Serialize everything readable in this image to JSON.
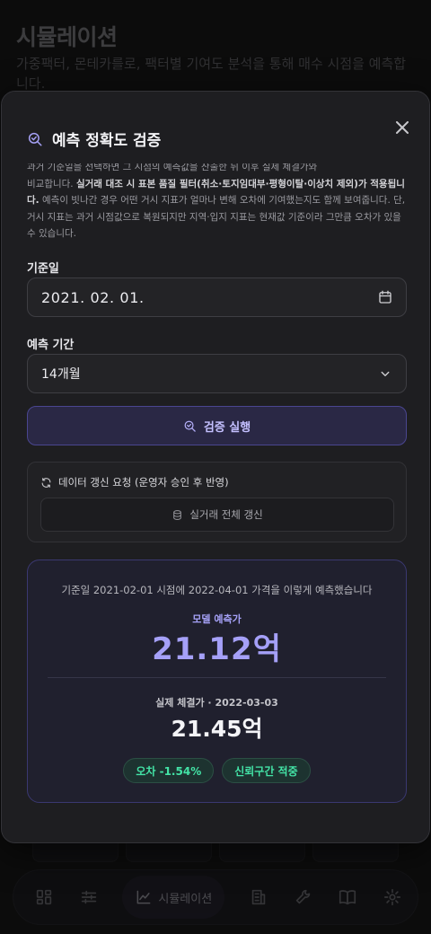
{
  "page": {
    "title": "시뮬레이션",
    "subtitle": "가중팩터, 몬테카를로, 팩터별 기여도 분석을 통해 매수 시점을 예측합니다."
  },
  "modal": {
    "title": "예측 정확도 검증",
    "description": {
      "line1": "과거 기준일을 선택하면 그 시점의 예측값을 산출한 뒤 이후 실제 체결가와",
      "intro": "비교합니다. ",
      "bold": "실거래 대조 시 표본 품질 필터(취소·토지임대부·평형이탈·이상치 제외)가 적용됩니다.",
      "rest": " 예측이 빗나간 경우 어떤 거시 지표가 얼마나 변해 오차에 기여했는지도 함께 보여줍니다. 단, 거시 지표는 과거 시점값으로 복원되지만 지역·입지 지표는 현재값 기준이라 그만큼 오차가 있을 수 있습니다."
    },
    "base_date": {
      "label": "기준일",
      "value": "2021. 02. 01."
    },
    "period": {
      "label": "예측 기간",
      "value": "14개월"
    },
    "run_button": "검증 실행",
    "refresh": {
      "title": "데이터 갱신 요청 (운영자 승인 후 반영)",
      "button": "실거래 전체 갱신"
    },
    "result": {
      "caption": "기준일 2021-02-01 시점에 2022-04-01 가격을 이렇게 예측했습니다",
      "pred_label": "모델 예측가",
      "pred_value": "21.12억",
      "actual_label": "실제 체결가 · 2022-03-03",
      "actual_value": "21.45억",
      "error_badge": "오차 -1.54%",
      "ci_badge": "신뢰구간 적중"
    }
  },
  "nav": {
    "active_label": "시뮬레이션",
    "icons": [
      "dashboard-icon",
      "sliders-icon",
      "chart-icon",
      "building-icon",
      "wrench-icon",
      "book-icon",
      "gear-icon"
    ]
  },
  "colors": {
    "accent": "#a5a0f8",
    "success": "#43e3a6",
    "modal_bg": "#1e1e21"
  }
}
